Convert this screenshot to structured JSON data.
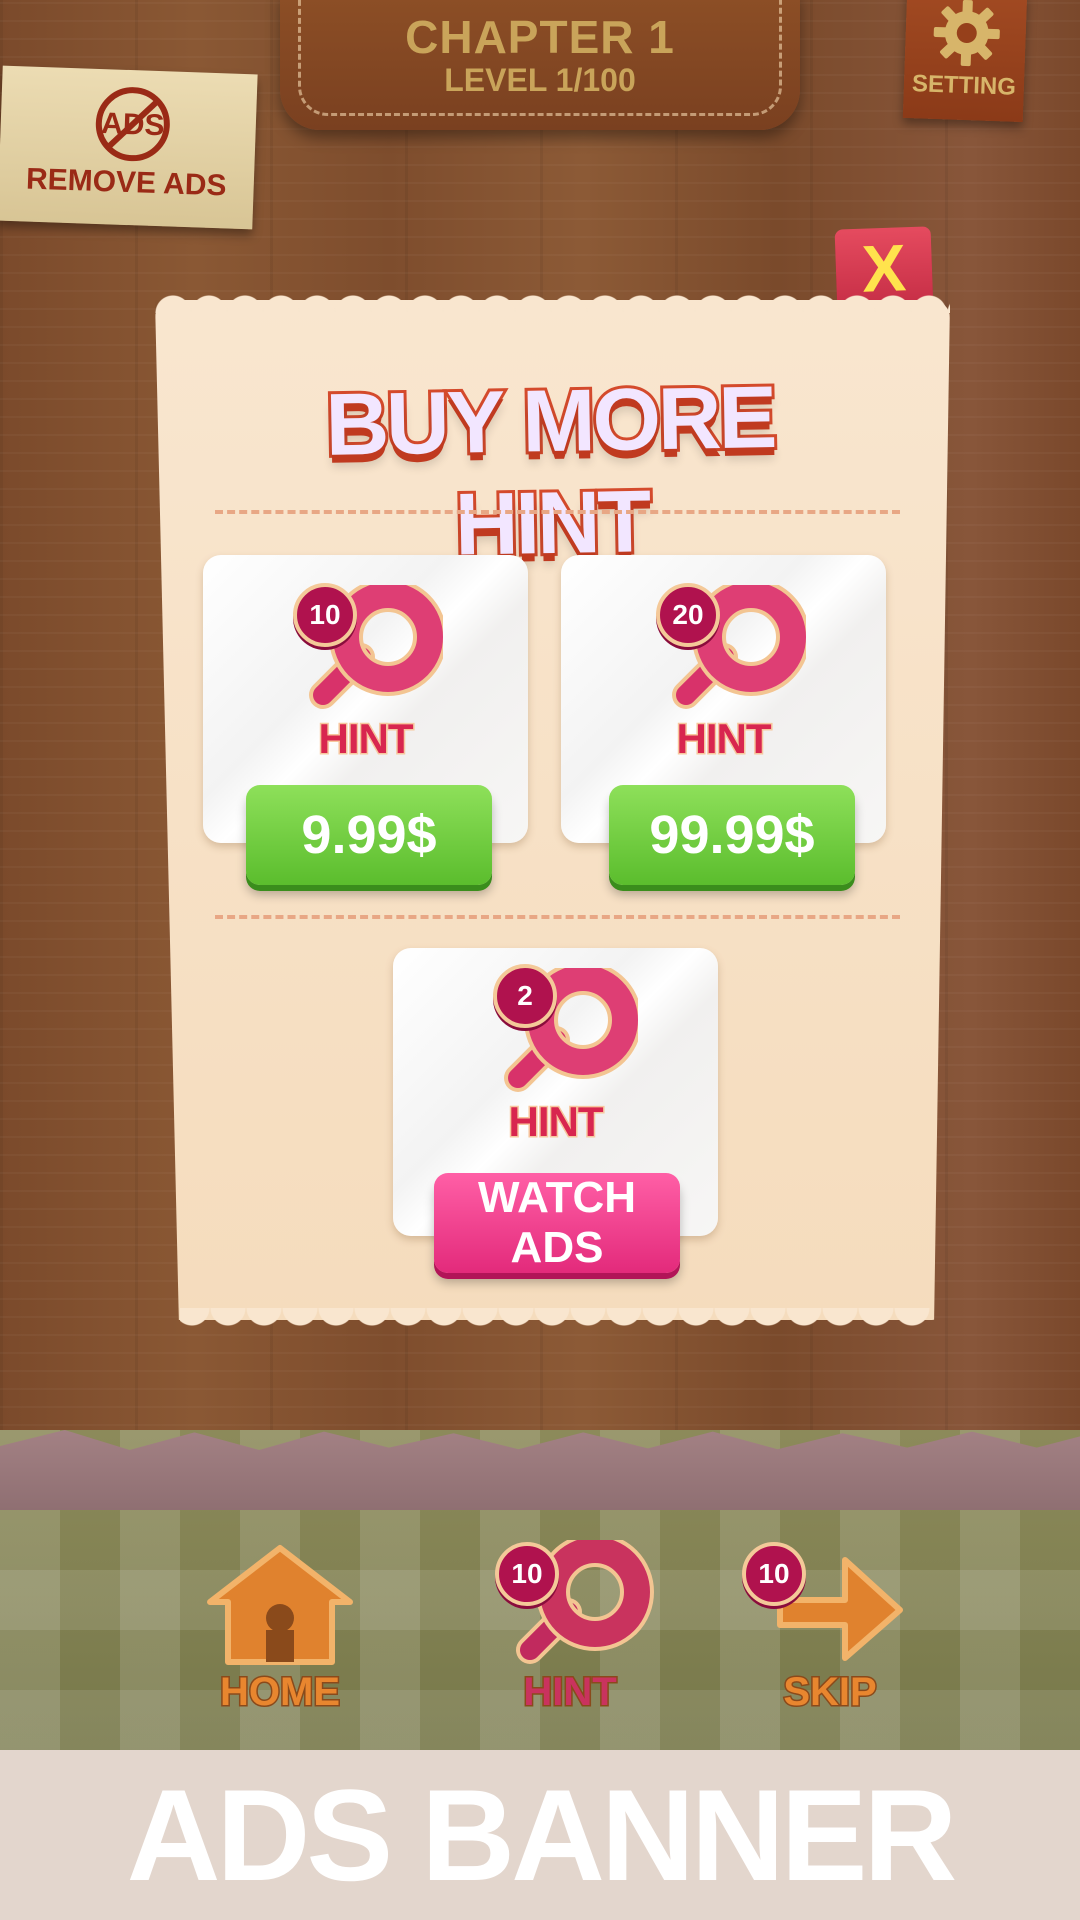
{
  "header": {
    "chapter": "CHAPTER 1",
    "level": "LEVEL 1/100"
  },
  "remove_ads": {
    "label": "REMOVE ADS",
    "icon": "no-ads-icon"
  },
  "setting": {
    "label": "SETTING",
    "icon": "gear-icon"
  },
  "popup": {
    "title": "BUY MORE HINT",
    "close_label": "X",
    "offers": [
      {
        "count": "10",
        "label": "HINT",
        "price": "9.99$"
      },
      {
        "count": "20",
        "label": "HINT",
        "price": "99.99$"
      }
    ],
    "ad_offer": {
      "count": "2",
      "label": "HINT",
      "button": "WATCH ADS"
    }
  },
  "bottom_nav": {
    "home": {
      "label": "HOME",
      "icon": "house-icon"
    },
    "hint": {
      "label": "HINT",
      "count": "10",
      "icon": "magnifier-icon"
    },
    "skip": {
      "label": "SKIP",
      "count": "10",
      "icon": "arrow-icon"
    }
  },
  "ads_banner": {
    "label": "ADS BANNER"
  },
  "colors": {
    "accent_pink": "#e32a7b",
    "price_green": "#5bbd2d",
    "title_red": "#d44a2c"
  }
}
